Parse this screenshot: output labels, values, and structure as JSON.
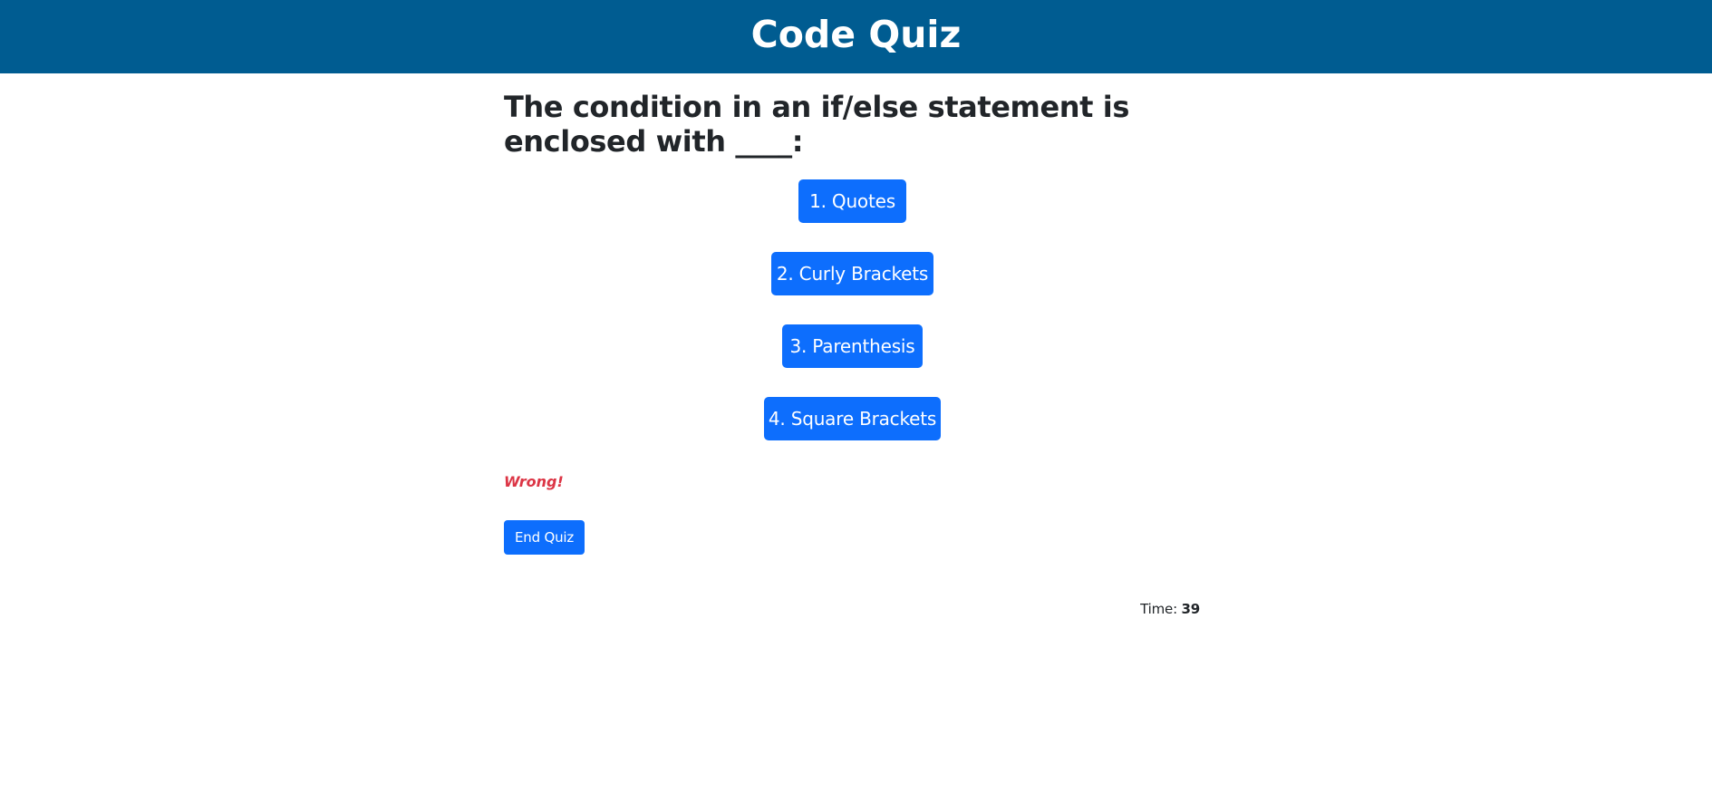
{
  "header": {
    "title": "Code Quiz"
  },
  "quiz": {
    "question": "The condition in an if/else statement is enclosed with ____:",
    "choices": [
      {
        "label": "1. Quotes"
      },
      {
        "label": "2. Curly Brackets"
      },
      {
        "label": "3. Parenthesis"
      },
      {
        "label": "4. Square Brackets"
      }
    ],
    "feedback": "Wrong!",
    "end_label": "End Quiz"
  },
  "timer": {
    "label": "Time:",
    "value": "39"
  },
  "colors": {
    "header_bg": "#005c91",
    "button_bg": "#0d6efd",
    "feedback_text": "#dc3545"
  }
}
